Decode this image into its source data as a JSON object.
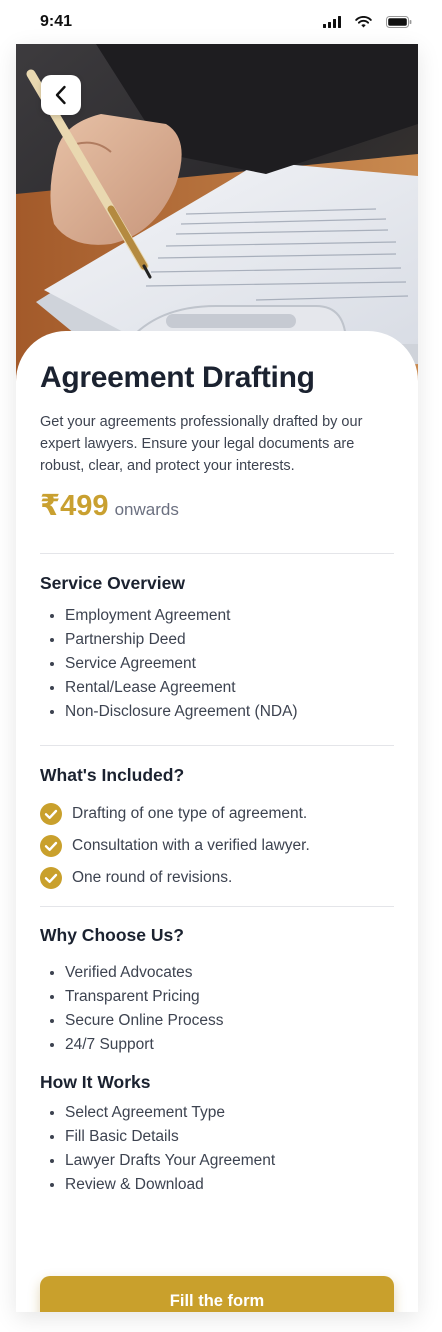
{
  "status_bar": {
    "time": "9:41"
  },
  "header": {
    "back_icon": "chevron-left-icon"
  },
  "hero": {
    "image": "hand writing with pen on document"
  },
  "page": {
    "title": "Agreement Drafting",
    "description": "Get your agreements professionally drafted by our expert lawyers. Ensure your legal documents are robust, clear, and protect your interests.",
    "price": "₹499",
    "price_suffix": "onwards"
  },
  "service_overview": {
    "title": "Service Overview",
    "items": [
      "Employment Agreement",
      "Partnership Deed",
      "Service Agreement",
      "Rental/Lease Agreement",
      "Non-Disclosure Agreement (NDA)"
    ]
  },
  "whats_included": {
    "title": "What's Included?",
    "items": [
      "Drafting of one type of agreement.",
      "Consultation with a verified lawyer.",
      "One round of revisions."
    ]
  },
  "why_choose_us": {
    "title": "Why Choose Us?",
    "items": [
      "Verified Advocates",
      "Transparent Pricing",
      "Secure Online Process",
      "24/7 Support"
    ]
  },
  "how_it_works": {
    "title": "How It Works",
    "items": [
      "Select Agreement Type",
      "Fill Basic Details",
      "Lawyer Drafts Your Agreement",
      "Review & Download"
    ]
  },
  "cta": {
    "label": "Fill the form"
  },
  "colors": {
    "accent": "#c9a02c",
    "title": "#1b2230",
    "body": "#3d4350"
  }
}
